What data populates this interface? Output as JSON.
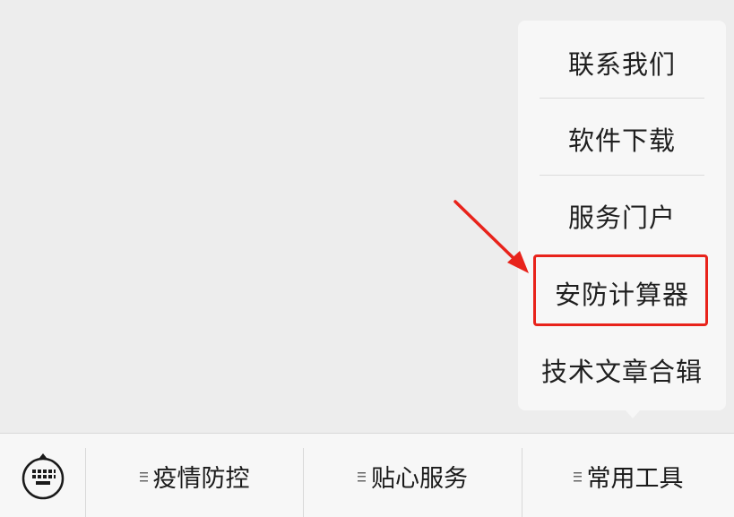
{
  "popup_menu": {
    "items": [
      {
        "label": "联系我们"
      },
      {
        "label": "软件下载"
      },
      {
        "label": "服务门户"
      },
      {
        "label": "安防计算器"
      },
      {
        "label": "技术文章合辑"
      }
    ],
    "highlight_color": "#e8231b"
  },
  "bottom_menu": {
    "keyboard_icon": "keyboard-icon",
    "tabs": [
      {
        "label": "疫情防控",
        "icon": "menu-lines-icon"
      },
      {
        "label": "贴心服务",
        "icon": "menu-lines-icon"
      },
      {
        "label": "常用工具",
        "icon": "menu-lines-icon"
      }
    ]
  }
}
